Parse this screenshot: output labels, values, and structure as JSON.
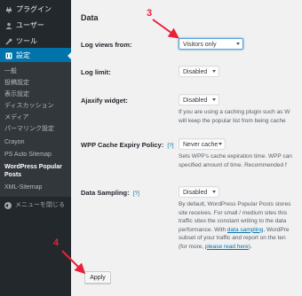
{
  "sidebar": {
    "menu": [
      {
        "label": "プラグイン",
        "icon": "plugin-icon"
      },
      {
        "label": "ユーザー",
        "icon": "users-icon"
      },
      {
        "label": "ツール",
        "icon": "wrench-icon"
      },
      {
        "label": "設定",
        "icon": "settings-icon"
      }
    ],
    "submenu": [
      "一般",
      "投稿設定",
      "表示設定",
      "ディスカッション",
      "メディア",
      "パーマリンク設定",
      "Crayon",
      "PS Auto Sitemap",
      "WordPress Popular",
      "Posts",
      "XML-Sitemap"
    ],
    "collapse_label": "メニューを閉じる"
  },
  "main": {
    "section_title": "Data",
    "log_views": {
      "label": "Log views from:",
      "value": "Visitors only"
    },
    "log_limit": {
      "label": "Log limit:",
      "value": "Disabled"
    },
    "ajaxify": {
      "label": "Ajaxify widget:",
      "value": "Disabled",
      "desc": [
        "If you are using a caching plugin such as W",
        "will keep the popular list from being cache"
      ]
    },
    "cache_expiry": {
      "label": "WPP Cache Expiry Policy:",
      "help": "[?]",
      "value": "Never cache",
      "desc": [
        "Sets WPP's cache expiration time. WPP can",
        "specified amount of time. Recommended f"
      ]
    },
    "sampling": {
      "label": "Data Sampling:",
      "help": "[?]",
      "value": "Disabled",
      "desc_lines": [
        "By default, WordPress Popular Posts stores",
        "site receives. For small / medium sites this",
        "traffic sites the constant writing to the data",
        "performance. With ",
        "data sampling",
        ", WordPre",
        "subset of your traffic and report on the ten",
        "(for more, ",
        "please read here",
        ")."
      ]
    },
    "apply_label": "Apply"
  },
  "annotations": {
    "step3": "3",
    "step4": "4",
    "color": "#e8213a"
  },
  "colors": {
    "sidebar_bg": "#23282d",
    "submenu_bg": "#32373c",
    "active_bg": "#0073aa",
    "content_bg": "#f1f1f1",
    "link": "#0073aa"
  }
}
